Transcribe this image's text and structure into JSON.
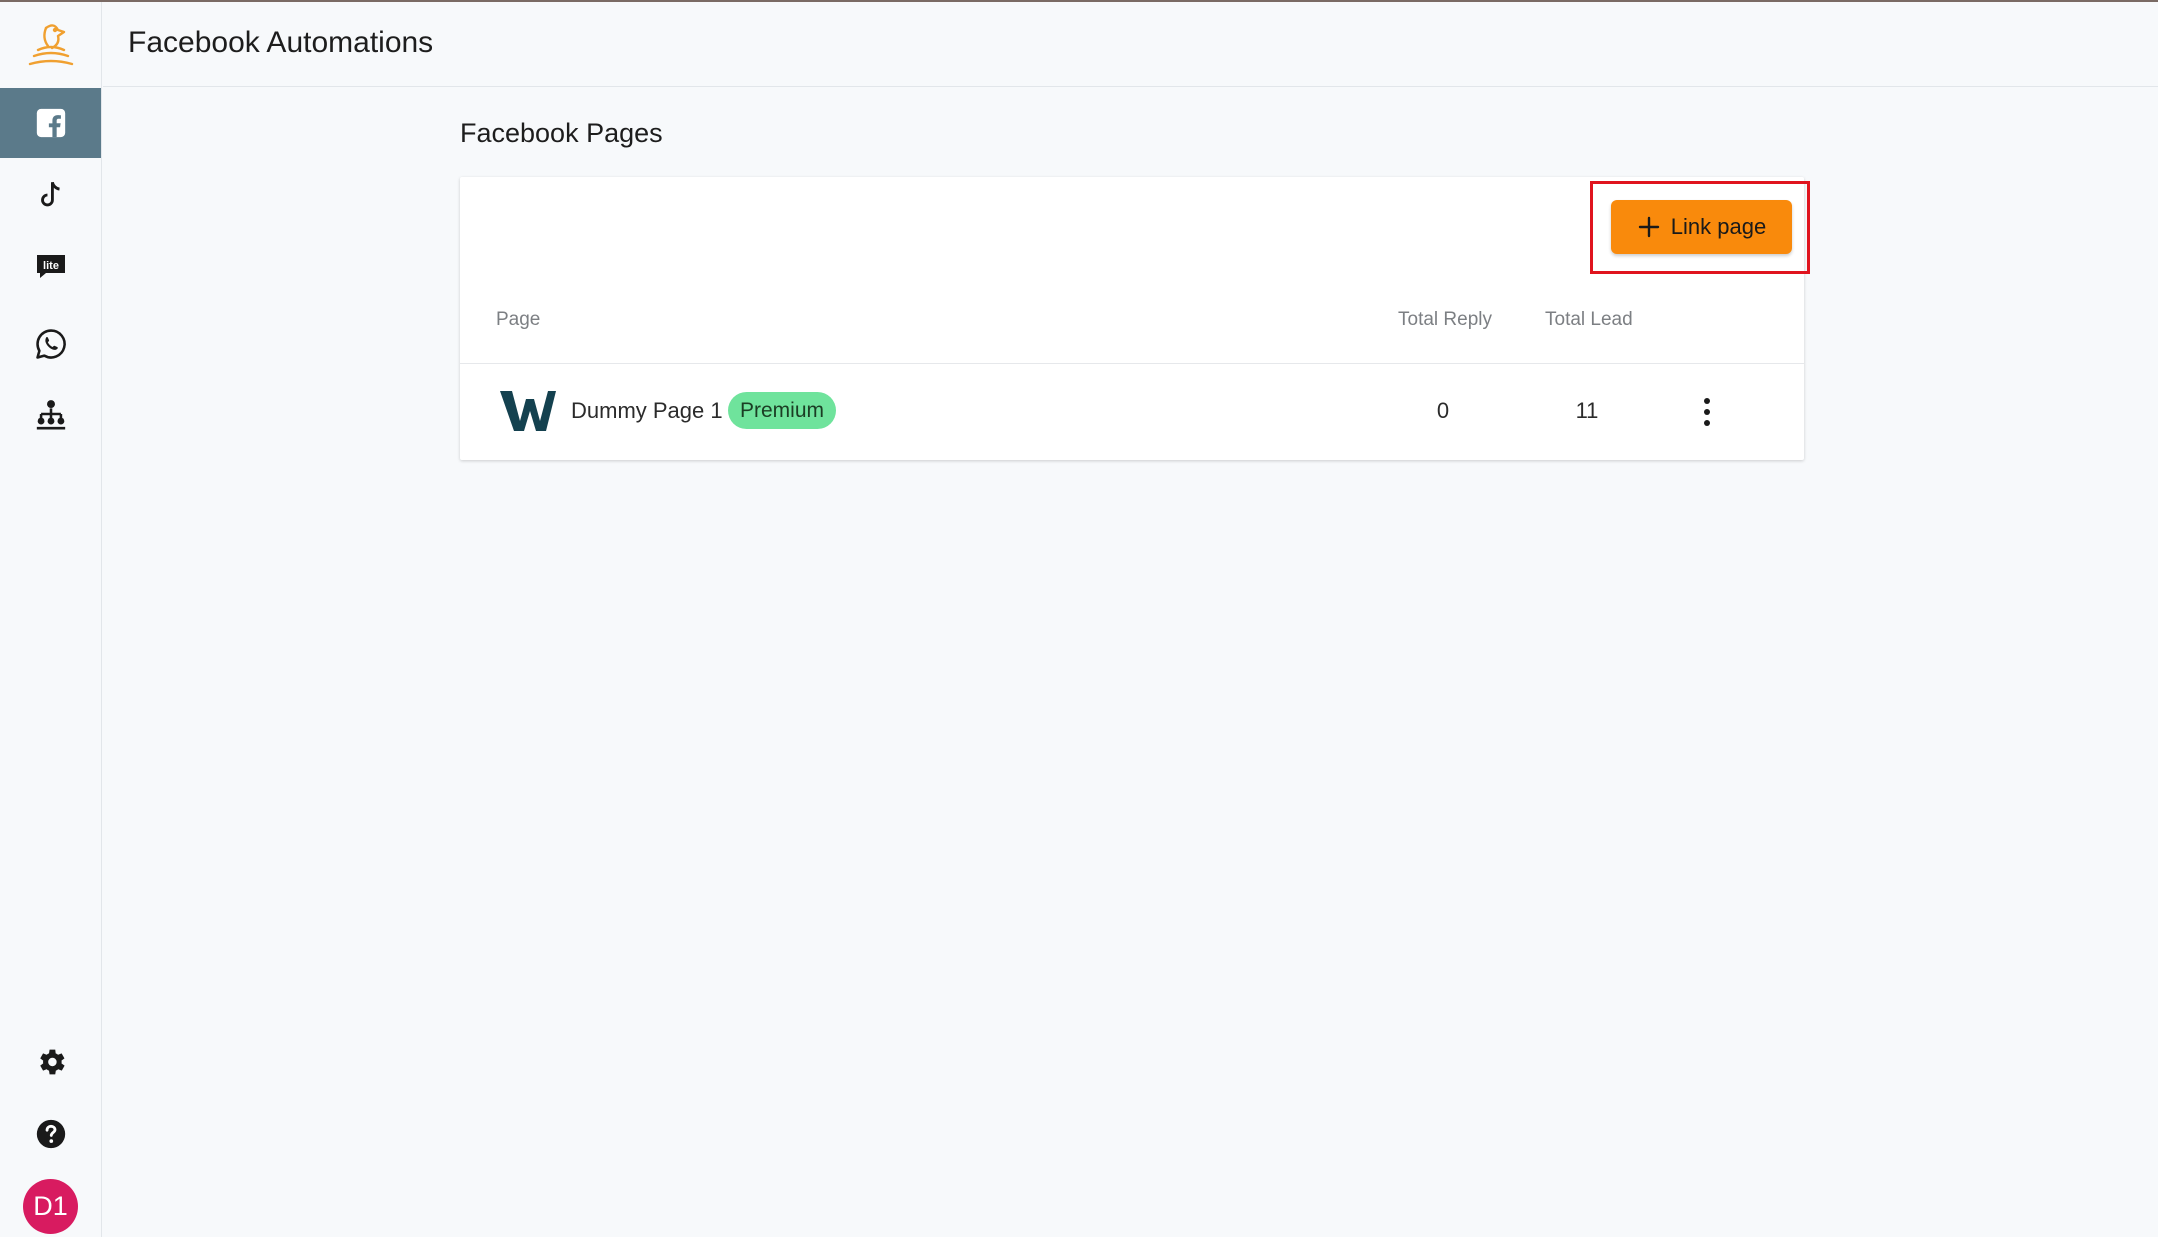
{
  "header": {
    "title": "Facebook Automations"
  },
  "sidebar": {
    "items": [
      {
        "name": "facebook",
        "icon": "facebook-icon",
        "active": true
      },
      {
        "name": "tiktok",
        "icon": "tiktok-icon",
        "active": false
      },
      {
        "name": "lite",
        "icon": "lite-icon",
        "active": false
      },
      {
        "name": "whatsapp",
        "icon": "whatsapp-icon",
        "active": false
      },
      {
        "name": "org-chart",
        "icon": "sitemap-icon",
        "active": false
      }
    ],
    "bottom": [
      {
        "name": "settings",
        "icon": "gear-icon"
      },
      {
        "name": "help",
        "icon": "question-icon"
      }
    ],
    "avatar_initials": "D1",
    "avatar_color": "#d81b60",
    "lite_label": "lite"
  },
  "main": {
    "section_title": "Facebook Pages",
    "link_button_label": "Link page",
    "table": {
      "columns": [
        "Page",
        "Total Reply",
        "Total Lead"
      ],
      "rows": [
        {
          "page": "Dummy Page 1",
          "badge": "Premium",
          "total_reply": "0",
          "total_lead": "11"
        }
      ]
    }
  },
  "colors": {
    "accent": "#f98a0c",
    "active_nav": "#5b7a8a",
    "badge": "#6fe39c",
    "highlight": "#e0141e"
  }
}
